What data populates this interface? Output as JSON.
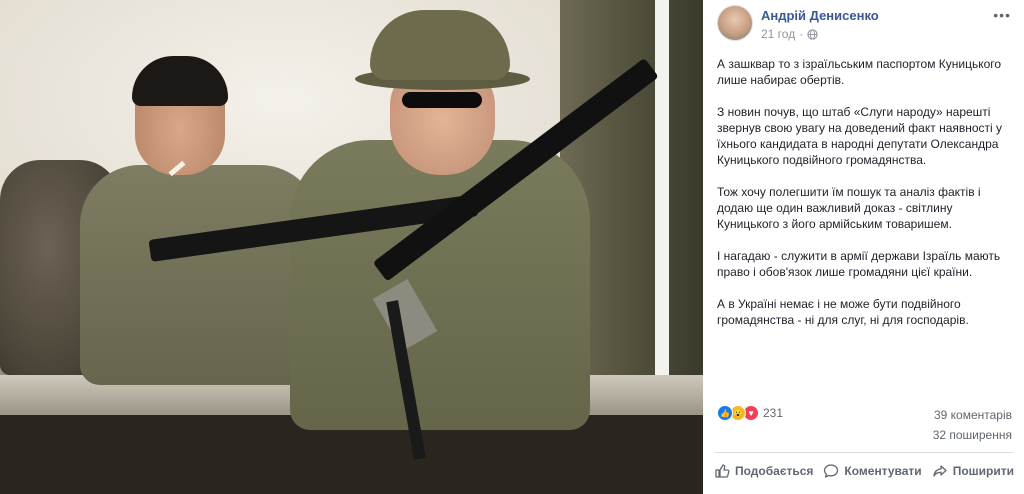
{
  "post": {
    "author": "Андрій Денисенко",
    "time": "21 год",
    "time_separator": "·",
    "more_label": "•••",
    "paragraphs": [
      "А зашквар то з ізраїльським паспортом Куницького лише набирає обертів.",
      "З новин почув, що штаб «Слуги народу» нарешті звернув свою увагу на доведений факт наявності у їхнього кандидата в народні депутати Олександра Куницького подвійного громадянства.",
      "Тож хочу полегшити їм пошук та аналіз фактів і додаю ще один важливий доказ - світлину Куницького з його армійським товаришем.",
      "І нагадаю - служити в армії держави Ізраїль мають право і обов'язок лише громадяни цієї країни.",
      "А в Україні немає і не може бути подвійного громадянства - ні для слуг, ні для господарів."
    ]
  },
  "reactions": {
    "like_glyph": "👍",
    "wow_glyph": "😮",
    "love_glyph": "♥",
    "count": "231"
  },
  "stats": {
    "comments": "39 коментарів",
    "shares": "32 поширення"
  },
  "actions": {
    "like": "Подобається",
    "comment": "Коментувати",
    "share": "Поширити"
  },
  "colors": {
    "author": "#385898",
    "like": "#1877f2",
    "wow": "#f7b928",
    "love": "#f33e58",
    "muted": "#606770"
  }
}
